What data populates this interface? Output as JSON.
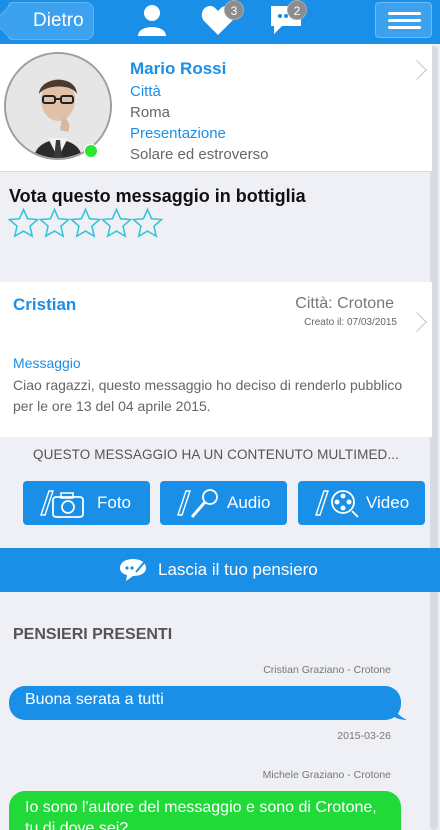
{
  "header": {
    "back_label": "Dietro",
    "likes_badge": "3",
    "messages_badge": "2"
  },
  "profile": {
    "name": "Mario Rossi",
    "city_label": "Città",
    "city_value": "Roma",
    "presentation_label": "Presentazione",
    "presentation_value": "Solare ed estroverso",
    "online": true
  },
  "vote": {
    "title": "Vota questo messaggio in bottiglia",
    "rating": 0,
    "max": 5
  },
  "message": {
    "author": "Cristian",
    "city": "Città: Crotone",
    "created": "Creato il: 07/03/2015",
    "label": "Messaggio",
    "text": "Ciao ragazzi, questo messaggio ho deciso di renderlo pubblico per le ore 13 del 04 aprile 2015."
  },
  "multimedia_note": "QUESTO MESSAGGIO HA UN CONTENUTO MULTIMED...",
  "media_buttons": {
    "foto": "Foto",
    "audio": "Audio",
    "video": "Video"
  },
  "leave_thought_label": "Lascia il tuo pensiero",
  "thoughts": {
    "title": "PENSIERI PRESENTI",
    "items": [
      {
        "author": "Cristian Graziano - Crotone",
        "text": "Buona serata a tutti",
        "date": "2015-03-26",
        "color": "#1a8fe8"
      },
      {
        "author": "Michele Graziano - Crotone",
        "text": "Io sono l'autore del messaggio e sono di Crotone, tu di dove sei?",
        "color": "#22d93a"
      }
    ]
  },
  "colors": {
    "accent": "#1a8fe8",
    "online": "#2ee62e",
    "star_outline": "#35c4d8"
  }
}
